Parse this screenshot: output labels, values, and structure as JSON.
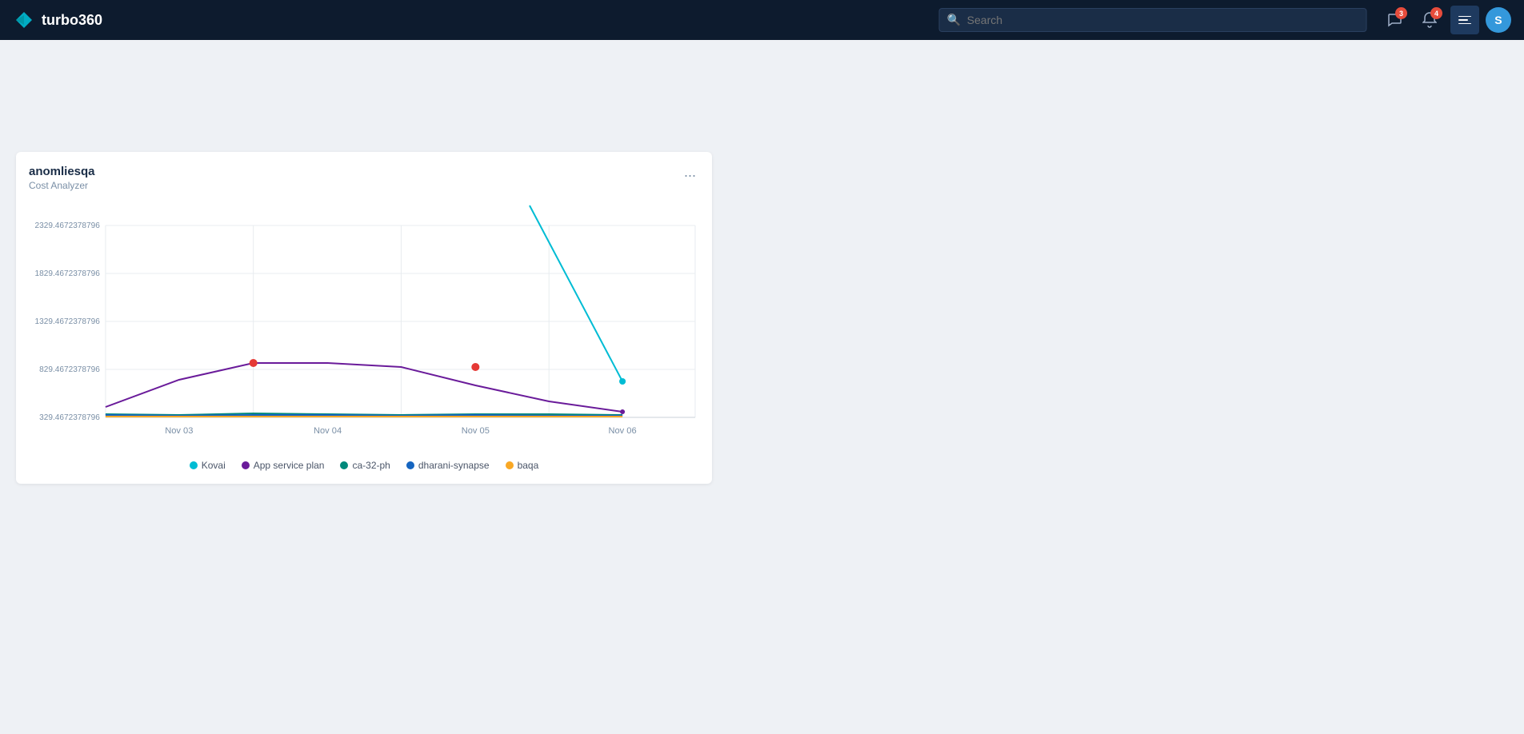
{
  "header": {
    "logo_text": "turbo360",
    "search_placeholder": "Search",
    "notifications_count": "3",
    "alerts_count": "4",
    "user_initial": "S"
  },
  "chart": {
    "title": "anomliesqa",
    "subtitle": "Cost Analyzer",
    "menu_label": "...",
    "y_axis": [
      "2329.4672378796",
      "1829.4672378796",
      "1329.4672378796",
      "829.4672378796",
      "329.4672378796"
    ],
    "x_axis": [
      "Nov 03",
      "Nov 04",
      "Nov 05",
      "Nov 06"
    ],
    "legend": [
      {
        "name": "Kovai",
        "color": "#00bcd4"
      },
      {
        "name": "App service plan",
        "color": "#6a1b9a"
      },
      {
        "name": "ca-32-ph",
        "color": "#00897b"
      },
      {
        "name": "dharani-synapse",
        "color": "#1565c0"
      },
      {
        "name": "baqa",
        "color": "#f9a825"
      }
    ]
  }
}
